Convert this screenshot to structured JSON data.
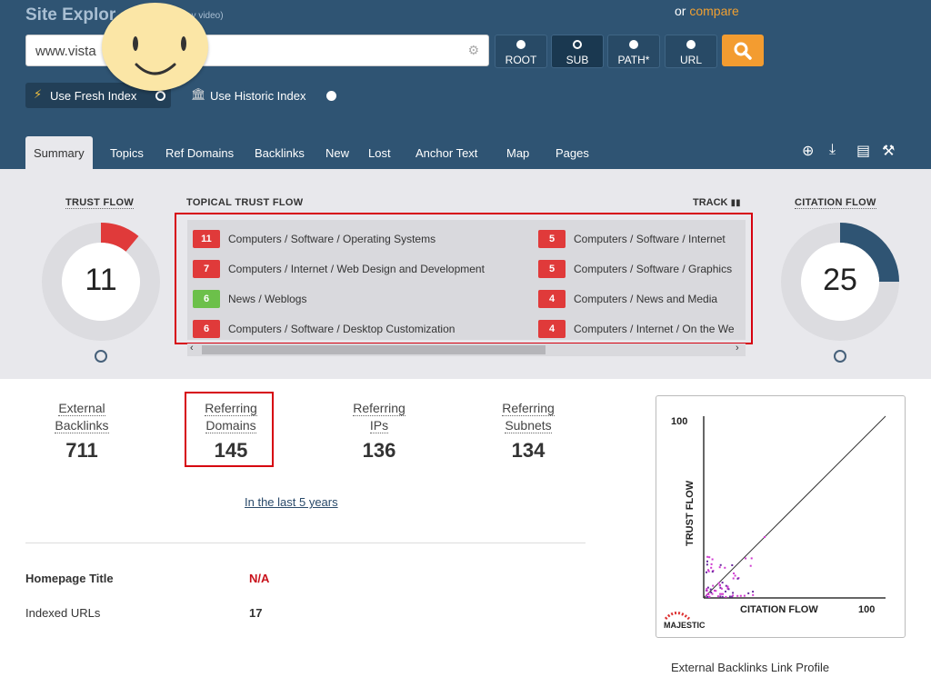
{
  "header": {
    "title": "Site Explor",
    "subtitle": "ay video)",
    "or_text": "or",
    "compare": "compare",
    "url_value": "www.vista",
    "scopes": [
      {
        "label": "ROOT",
        "active": false
      },
      {
        "label": "SUB",
        "active": true
      },
      {
        "label": "PATH*",
        "active": false
      },
      {
        "label": "URL",
        "active": false
      }
    ],
    "fresh_index": "Use Fresh Index",
    "historic_index": "Use Historic Index"
  },
  "tabs": [
    "Summary",
    "Topics",
    "Ref Domains",
    "Backlinks",
    "New",
    "Lost",
    "Anchor Text",
    "Map",
    "Pages"
  ],
  "metrics": {
    "trust_flow_title": "TRUST FLOW",
    "trust_flow_value": "11",
    "citation_flow_title": "CITATION FLOW",
    "citation_flow_value": "25"
  },
  "topical": {
    "title": "TOPICAL TRUST FLOW",
    "track": "TRACK",
    "rows": [
      {
        "value": "11",
        "label": "Computers / Software / Operating Systems",
        "color": "#e03a3a"
      },
      {
        "value": "7",
        "label": "Computers / Internet / Web Design and Development",
        "color": "#e03a3a"
      },
      {
        "value": "6",
        "label": "News / Weblogs",
        "color": "#6cc04a"
      },
      {
        "value": "6",
        "label": "Computers / Software / Desktop Customization",
        "color": "#e03a3a"
      },
      {
        "value": "5",
        "label": "Computers / Software / Internet",
        "color": "#e03a3a"
      },
      {
        "value": "5",
        "label": "Computers / Software / Graphics",
        "color": "#e03a3a"
      },
      {
        "value": "4",
        "label": "Computers / News and Media",
        "color": "#e03a3a"
      },
      {
        "value": "4",
        "label": "Computers / Internet / On the We",
        "color": "#e03a3a"
      }
    ]
  },
  "stats": [
    {
      "line1": "External",
      "line2": "Backlinks",
      "value": "711"
    },
    {
      "line1": "Referring",
      "line2": "Domains",
      "value": "145"
    },
    {
      "line1": "Referring",
      "line2": "IPs",
      "value": "136"
    },
    {
      "line1": "Referring",
      "line2": "Subnets",
      "value": "134"
    }
  ],
  "last5": "In the last 5 years",
  "info": {
    "homepage_title_label": "Homepage Title",
    "homepage_title_value": "N/A",
    "indexed_urls_label": "Indexed URLs",
    "indexed_urls_value": "17"
  },
  "scatter": {
    "y_max_label": "100",
    "x_max_label": "100",
    "y_axis": "TRUST FLOW",
    "x_axis": "CITATION FLOW",
    "brand": "MAJESTIC",
    "caption": "External Backlinks Link Profile"
  },
  "colors": {
    "header_bg": "#2f5473",
    "accent_orange": "#f39c30",
    "highlight_red": "#d6000f",
    "citation_blue": "#2f5473",
    "trust_red": "#e03a3a"
  }
}
